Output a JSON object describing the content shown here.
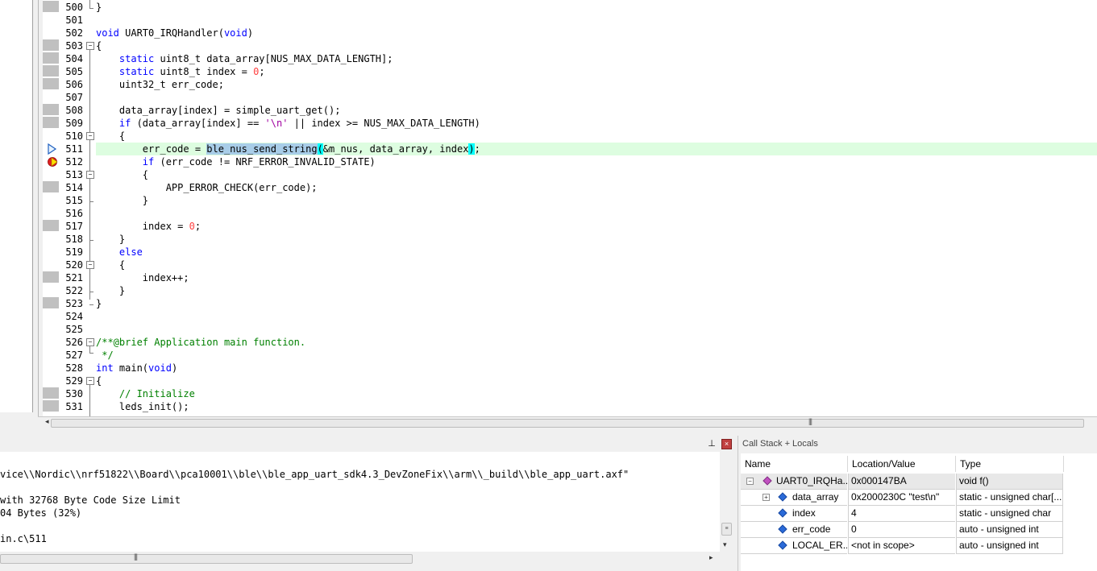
{
  "editor": {
    "line_numbers": [
      "500",
      "501",
      "502",
      "503",
      "504",
      "505",
      "506",
      "507",
      "508",
      "509",
      "510",
      "511",
      "512",
      "513",
      "514",
      "515",
      "516",
      "517",
      "518",
      "519",
      "520",
      "521",
      "522",
      "523",
      "524",
      "525",
      "526",
      "527",
      "528",
      "529",
      "530",
      "531"
    ],
    "lines": [
      "}",
      "",
      "void UART0_IRQHandler(void)",
      "{",
      "    static uint8_t data_array[NUS_MAX_DATA_LENGTH];",
      "    static uint8_t index = 0;",
      "    uint32_t err_code;",
      "",
      "    data_array[index] = simple_uart_get();",
      "    if (data_array[index] == '\\n' || index >= NUS_MAX_DATA_LENGTH)",
      "    {",
      "        err_code = ble_nus_send_string(&m_nus, data_array, index);",
      "        if (err_code != NRF_ERROR_INVALID_STATE)",
      "        {",
      "            APP_ERROR_CHECK(err_code);",
      "        }",
      "",
      "        index = 0;",
      "    }",
      "    else",
      "    {",
      "        index++;",
      "    }",
      "}",
      "",
      "",
      "/**@brief Application main function.",
      " */",
      "int main(void)",
      "{",
      "    // Initialize",
      "    leds_init();"
    ]
  },
  "build_output": {
    "lines": [
      "vice\\\\Nordic\\\\nrf51822\\\\Board\\\\pca10001\\\\ble\\\\ble_app_uart_sdk4.3_DevZoneFix\\\\arm\\\\_build\\\\ble_app_uart.axf\"",
      "",
      "with 32768 Byte Code Size Limit",
      "04 Bytes (32%)",
      "",
      "in.c\\511"
    ]
  },
  "call_stack": {
    "title": "Call Stack + Locals",
    "columns": [
      "Name",
      "Location/Value",
      "Type"
    ],
    "rows": [
      {
        "name": "UART0_IRQHa...",
        "value": "0x000147BA",
        "type": "void f()"
      },
      {
        "name": "data_array",
        "value": "0x2000230C \"test\\n\"",
        "type": "static - unsigned char[..."
      },
      {
        "name": "index",
        "value": "4",
        "type": "static - unsigned char"
      },
      {
        "name": "err_code",
        "value": "0",
        "type": "auto - unsigned int"
      },
      {
        "name": "LOCAL_ER...",
        "value": "<not in scope>",
        "type": "auto - unsigned int"
      }
    ]
  },
  "colors": {
    "keyword": "#0000ff",
    "comment": "#008000",
    "number": "#ff4040",
    "string": "#a000a0",
    "current_line": "#ddfde0",
    "selection": "#a8cde8"
  },
  "icons": {
    "execution_arrow": "current-line-arrow-icon",
    "breakpoint": "breakpoint-icon",
    "pin": "pin-icon",
    "close": "close-icon",
    "function": "function-diamond-icon",
    "variable": "variable-diamond-icon"
  }
}
